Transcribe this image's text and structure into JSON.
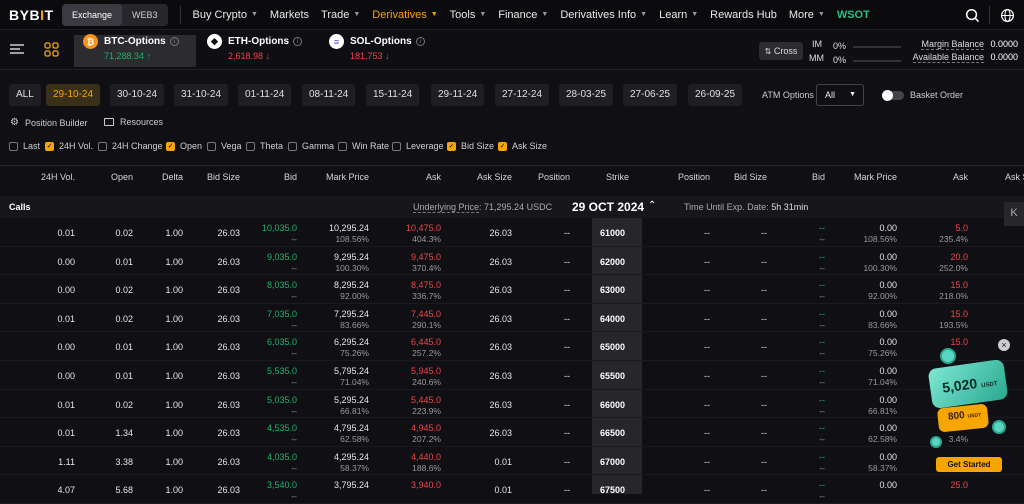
{
  "nav": {
    "logo_a": "BYB",
    "logo_b": "I",
    "logo_c": "T",
    "exchange": "Exchange",
    "web3": "WEB3",
    "items": [
      "Buy Crypto",
      "Markets",
      "Trade",
      "Derivatives",
      "Tools",
      "Finance",
      "Derivatives Info",
      "Learn",
      "Rewards Hub",
      "More"
    ],
    "wsot": "WSOT"
  },
  "tickers": [
    {
      "name": "BTC-Options",
      "price": "71,288.34",
      "dir": "up",
      "coin": "₿",
      "color": "#f7931a"
    },
    {
      "name": "ETH-Options",
      "price": "2,618.98",
      "dir": "dn",
      "coin": "◆",
      "color": "#ffffff"
    },
    {
      "name": "SOL-Options",
      "price": "181.753",
      "dir": "dn",
      "coin": "≡",
      "color": "#ffffff"
    }
  ],
  "account": {
    "cross": "Cross",
    "im": "IM",
    "im_val": "0%",
    "mm": "MM",
    "mm_val": "0%",
    "margin_balance": "Margin Balance",
    "margin_val": "0.0000",
    "available_balance": "Available Balance",
    "available_val": "0.0000"
  },
  "expiries": {
    "all": "ALL",
    "dates": [
      "29-10-24",
      "30-10-24",
      "31-10-24",
      "01-11-24",
      "08-11-24",
      "15-11-24",
      "29-11-24",
      "27-12-24",
      "28-03-25",
      "27-06-25",
      "26-09-25"
    ],
    "atm_label": "ATM Options",
    "atm_value": "All",
    "basket": "Basket Order"
  },
  "tools": {
    "position_builder": "Position Builder",
    "resources": "Resources"
  },
  "columns_toggle": [
    {
      "label": "Last",
      "checked": false
    },
    {
      "label": "24H Vol.",
      "checked": true
    },
    {
      "label": "24H Change",
      "checked": false
    },
    {
      "label": "Open",
      "checked": true
    },
    {
      "label": "Vega",
      "checked": false
    },
    {
      "label": "Theta",
      "checked": false
    },
    {
      "label": "Gamma",
      "checked": false
    },
    {
      "label": "Win Rate",
      "checked": false
    },
    {
      "label": "Leverage",
      "checked": false
    },
    {
      "label": "Bid Size",
      "checked": true
    },
    {
      "label": "Ask Size",
      "checked": true
    }
  ],
  "headers": {
    "calls": [
      "24H Vol.",
      "Open",
      "Delta",
      "Bid Size",
      "Bid",
      "Mark Price",
      "Ask",
      "Ask Size",
      "Position"
    ],
    "strike": "Strike",
    "puts": [
      "Position",
      "Bid Size",
      "Bid",
      "Mark Price",
      "Ask",
      "Ask S"
    ]
  },
  "calls_bar": {
    "calls": "Calls",
    "underlying_label": "Underlying Price",
    "underlying_value": ": 71,295.24 USDC",
    "date": "29 OCT 2024",
    "time_label": "Time Until Exp. Date:",
    "time_value": "5h 31min"
  },
  "rows": [
    {
      "vol": "0.01",
      "open": "0.02",
      "delta": "1.00",
      "bidsize": "26.03",
      "bid": "10,035.0",
      "mark": "10,295.24",
      "markpct": "108.56%",
      "ask": "10,475.0",
      "askpct": "404.3%",
      "asksize": "26.03",
      "pos": "--",
      "strike": "61000",
      "ppos": "--",
      "pbidsize": "--",
      "pbid": "--",
      "pmark": "0.00",
      "pmarkpct": "108.56%",
      "pask": "5.0",
      "paskpct": "235.4%"
    },
    {
      "vol": "0.00",
      "open": "0.01",
      "delta": "1.00",
      "bidsize": "26.03",
      "bid": "9,035.0",
      "mark": "9,295.24",
      "markpct": "100.30%",
      "ask": "9,475.0",
      "askpct": "370.4%",
      "asksize": "26.03",
      "pos": "--",
      "strike": "62000",
      "ppos": "--",
      "pbidsize": "--",
      "pbid": "--",
      "pmark": "0.00",
      "pmarkpct": "100.30%",
      "pask": "20.0",
      "paskpct": "252.0%"
    },
    {
      "vol": "0.00",
      "open": "0.02",
      "delta": "1.00",
      "bidsize": "26.03",
      "bid": "8,035.0",
      "mark": "8,295.24",
      "markpct": "92.00%",
      "ask": "8,475.0",
      "askpct": "336.7%",
      "asksize": "26.03",
      "pos": "--",
      "strike": "63000",
      "ppos": "--",
      "pbidsize": "--",
      "pbid": "--",
      "pmark": "0.00",
      "pmarkpct": "92.00%",
      "pask": "15.0",
      "paskpct": "218.0%"
    },
    {
      "vol": "0.01",
      "open": "0.02",
      "delta": "1.00",
      "bidsize": "26.03",
      "bid": "7,035.0",
      "mark": "7,295.24",
      "markpct": "83.66%",
      "ask": "7,445.0",
      "askpct": "290.1%",
      "asksize": "26.03",
      "pos": "--",
      "strike": "64000",
      "ppos": "--",
      "pbidsize": "--",
      "pbid": "--",
      "pmark": "0.00",
      "pmarkpct": "83.66%",
      "pask": "15.0",
      "paskpct": "193.5%"
    },
    {
      "vol": "0.00",
      "open": "0.01",
      "delta": "1.00",
      "bidsize": "26.03",
      "bid": "6,035.0",
      "mark": "6,295.24",
      "markpct": "75.26%",
      "ask": "6,445.0",
      "askpct": "257.2%",
      "asksize": "26.03",
      "pos": "--",
      "strike": "65000",
      "ppos": "--",
      "pbidsize": "--",
      "pbid": "--",
      "pmark": "0.00",
      "pmarkpct": "75.26%",
      "pask": "15.0",
      "paskpct": ""
    },
    {
      "vol": "0.00",
      "open": "0.01",
      "delta": "1.00",
      "bidsize": "26.03",
      "bid": "5,535.0",
      "mark": "5,795.24",
      "markpct": "71.04%",
      "ask": "5,945.0",
      "askpct": "240.6%",
      "asksize": "26.03",
      "pos": "--",
      "strike": "65500",
      "ppos": "--",
      "pbidsize": "--",
      "pbid": "--",
      "pmark": "0.00",
      "pmarkpct": "71.04%",
      "pask": "",
      "paskpct": ""
    },
    {
      "vol": "0.01",
      "open": "0.02",
      "delta": "1.00",
      "bidsize": "26.03",
      "bid": "5,035.0",
      "mark": "5,295.24",
      "markpct": "66.81%",
      "ask": "5,445.0",
      "askpct": "223.9%",
      "asksize": "26.03",
      "pos": "--",
      "strike": "66000",
      "ppos": "--",
      "pbidsize": "--",
      "pbid": "--",
      "pmark": "0.00",
      "pmarkpct": "66.81%",
      "pask": "",
      "paskpct": ""
    },
    {
      "vol": "0.01",
      "open": "1.34",
      "delta": "1.00",
      "bidsize": "26.03",
      "bid": "4,535.0",
      "mark": "4,795.24",
      "markpct": "62.58%",
      "ask": "4,945.0",
      "askpct": "207.2%",
      "asksize": "26.03",
      "pos": "--",
      "strike": "66500",
      "ppos": "--",
      "pbidsize": "--",
      "pbid": "--",
      "pmark": "0.00",
      "pmarkpct": "62.58%",
      "pask": "",
      "paskpct": "3.4%"
    },
    {
      "vol": "1.11",
      "open": "3.38",
      "delta": "1.00",
      "bidsize": "26.03",
      "bid": "4,035.0",
      "mark": "4,295.24",
      "markpct": "58.37%",
      "ask": "4,440.0",
      "askpct": "188.6%",
      "asksize": "0.01",
      "pos": "--",
      "strike": "67000",
      "ppos": "--",
      "pbidsize": "--",
      "pbid": "--",
      "pmark": "0.00",
      "pmarkpct": "58.37%",
      "pask": "",
      "paskpct": ""
    },
    {
      "vol": "4.07",
      "open": "5.68",
      "delta": "1.00",
      "bidsize": "26.03",
      "bid": "3,540.0",
      "mark": "3,795.24",
      "markpct": "",
      "ask": "3,940.0",
      "askpct": "",
      "asksize": "0.01",
      "pos": "--",
      "strike": "67500",
      "ppos": "--",
      "pbidsize": "--",
      "pbid": "--",
      "pmark": "0.00",
      "pmarkpct": "",
      "pask": "25.0",
      "paskpct": ""
    }
  ],
  "promo": {
    "amount": "5,020",
    "unit": "USDT",
    "amount2": "800",
    "unit2": "USDT",
    "cta": "Get Started"
  },
  "colors": {
    "accent": "#f7a600",
    "up": "#20b26c",
    "down": "#ef454a",
    "bg": "#101014"
  }
}
